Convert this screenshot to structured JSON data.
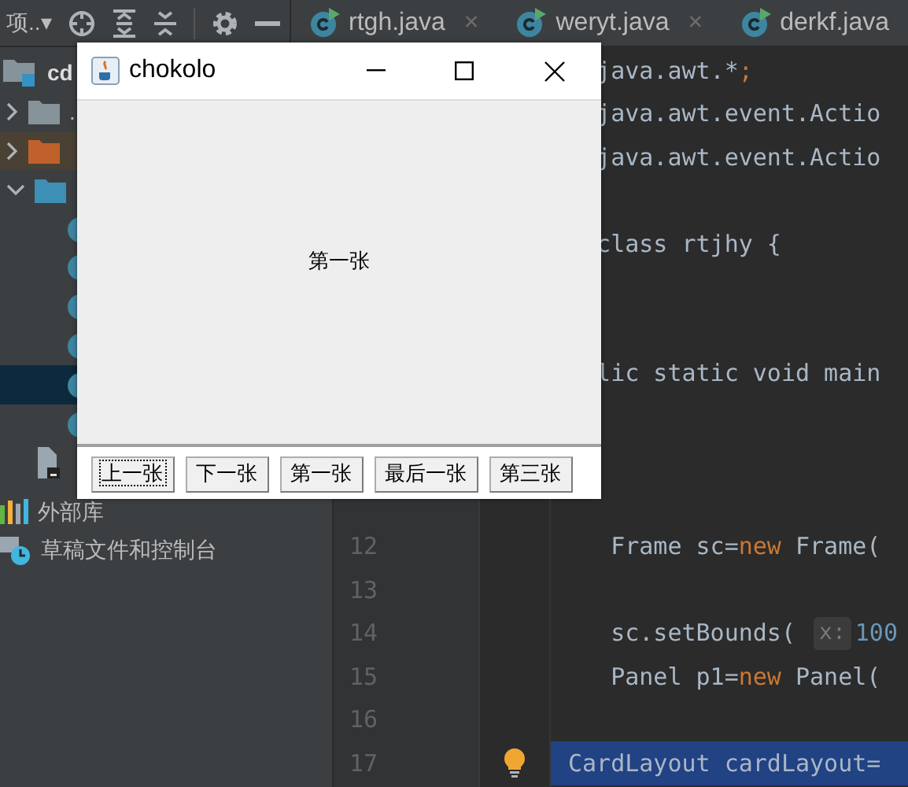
{
  "toolbar": {
    "view_label": "项..▾"
  },
  "tabs": [
    {
      "label": "rtgh.java",
      "close": "×"
    },
    {
      "label": "weryt.java",
      "close": "×"
    },
    {
      "label": "derkf.java"
    }
  ],
  "project_tree": [
    {
      "kind": "root",
      "label": "cd",
      "selected": false
    },
    {
      "kind": "folder",
      "label": ".",
      "color": "#87939a",
      "selected": false
    },
    {
      "kind": "folder",
      "color": "#c0612b",
      "selected": false,
      "tint": true
    },
    {
      "kind": "folder-open",
      "color": "#3d8fb5",
      "selected": false
    },
    {
      "kind": "class",
      "selected": false
    },
    {
      "kind": "class",
      "selected": false
    },
    {
      "kind": "class",
      "selected": false
    },
    {
      "kind": "class",
      "selected": false
    },
    {
      "kind": "class",
      "selected": true
    },
    {
      "kind": "class",
      "selected": false
    },
    {
      "kind": "file",
      "selected": false
    },
    {
      "kind": "library",
      "label": "外部库",
      "selected": false
    },
    {
      "kind": "scratch",
      "label": "草稿文件和控制台",
      "selected": false
    }
  ],
  "editor_lines": [
    {
      "kind": "code",
      "code": "  java.awt.*;"
    },
    {
      "kind": "code",
      "code": "  java.awt.event.Actio"
    },
    {
      "kind": "code",
      "code": "  java.awt.event.Actio"
    },
    {
      "kind": "blank"
    },
    {
      "kind": "code",
      "code": "  class rtjhy {"
    },
    {
      "kind": "blank"
    },
    {
      "kind": "blank"
    },
    {
      "kind": "code",
      "code": "  lic static void main"
    },
    {
      "kind": "blank"
    },
    {
      "kind": "blank"
    },
    {
      "kind": "blank"
    },
    {
      "kind": "code",
      "number": "12",
      "code": "   Frame sc=new Frame("
    },
    {
      "kind": "code",
      "number": "13"
    },
    {
      "kind": "code",
      "number": "14",
      "code": "   sc.setBounds( ",
      "hint": "x:",
      "after": "100"
    },
    {
      "kind": "code",
      "number": "15",
      "code": "   Panel p1=new Panel("
    },
    {
      "kind": "code",
      "number": "16"
    },
    {
      "kind": "code",
      "number": "17",
      "code": "CardLayout cardLayout=",
      "current": true,
      "bulb": true
    }
  ],
  "dialog": {
    "title": "chokolo",
    "card_text": "第一张",
    "buttons": [
      {
        "label": "上一张",
        "focused": true
      },
      {
        "label": "下一张",
        "focused": false
      },
      {
        "label": "第一张",
        "focused": false
      },
      {
        "label": "最后一张",
        "focused": false
      },
      {
        "label": "第三张",
        "focused": false
      }
    ]
  }
}
